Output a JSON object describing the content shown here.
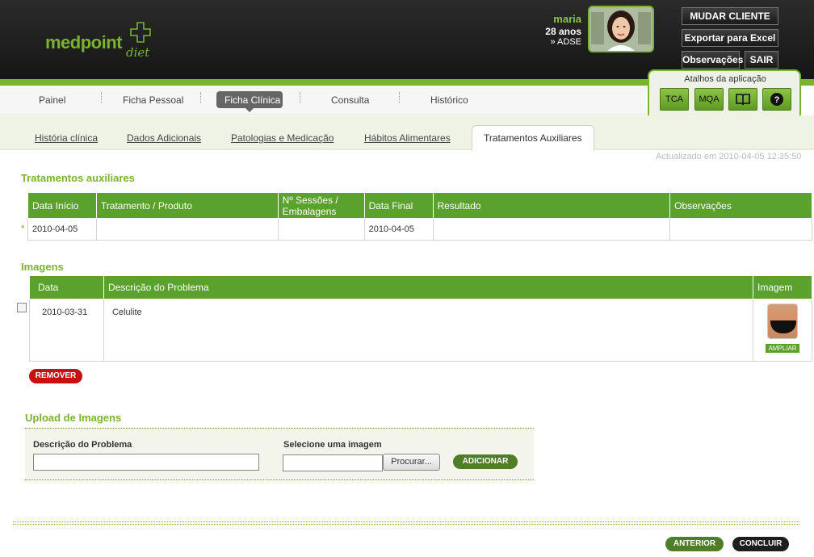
{
  "logo": {
    "main": "medpoint",
    "sub": "diet"
  },
  "patient": {
    "name": "maria",
    "age": "28 anos",
    "insurer": "» ADSE"
  },
  "header_buttons": {
    "change_client": "MUDAR CLIENTE",
    "export_excel": "Exportar para Excel",
    "observations": "Observações",
    "exit": "SAIR"
  },
  "shortcuts": {
    "title": "Atalhos da aplicação",
    "tca": "TCA",
    "mqa": "MQA",
    "book_icon": "book-icon",
    "help_icon": "help-icon"
  },
  "nav": [
    {
      "label": "Painel"
    },
    {
      "label": "Ficha Pessoal"
    },
    {
      "label": "Ficha Clínica",
      "active": true
    },
    {
      "label": "Consulta"
    },
    {
      "label": "Histórico"
    }
  ],
  "subtabs": [
    {
      "label": "História clínica"
    },
    {
      "label": "Dados Adicionais"
    },
    {
      "label": "Patologias e Medicação"
    },
    {
      "label": "Hábitos Alimentares"
    },
    {
      "label": "Tratamentos Auxiliares",
      "active": true
    }
  ],
  "updated_text": "Actualizado em 2010-04-05 12:35:50",
  "treatments": {
    "title": "Tratamentos auxiliares",
    "headers": [
      "Data Início",
      "Tratamento / Produto",
      "Nº Sessões / Embalagens",
      "Data Final",
      "Resultado",
      "Observações"
    ],
    "row_marker": "*",
    "rows": [
      [
        "2010-04-05",
        "",
        "",
        "2010-04-05",
        "",
        ""
      ]
    ]
  },
  "images": {
    "title": "Imagens",
    "headers": [
      "Data",
      "Descrição do Problema",
      "Imagem"
    ],
    "rows": [
      {
        "date": "2010-03-31",
        "description": "Celulite",
        "zoom_label": "AMPLIAR"
      }
    ],
    "remove_label": "REMOVER"
  },
  "upload": {
    "title": "Upload de Imagens",
    "description_label": "Descrição do Problema",
    "description_value": "",
    "file_label": "Selecione uma imagem",
    "file_value": "",
    "browse_label": "Procurar...",
    "add_label": "ADICIONAR"
  },
  "footer": {
    "previous": "ANTERIOR",
    "finish": "CONCLUIR"
  },
  "colors": {
    "brand_green": "#7ab32e",
    "table_header": "#5aa12d",
    "remove_red": "#c71010",
    "header_dark": "#1f1f1f"
  }
}
